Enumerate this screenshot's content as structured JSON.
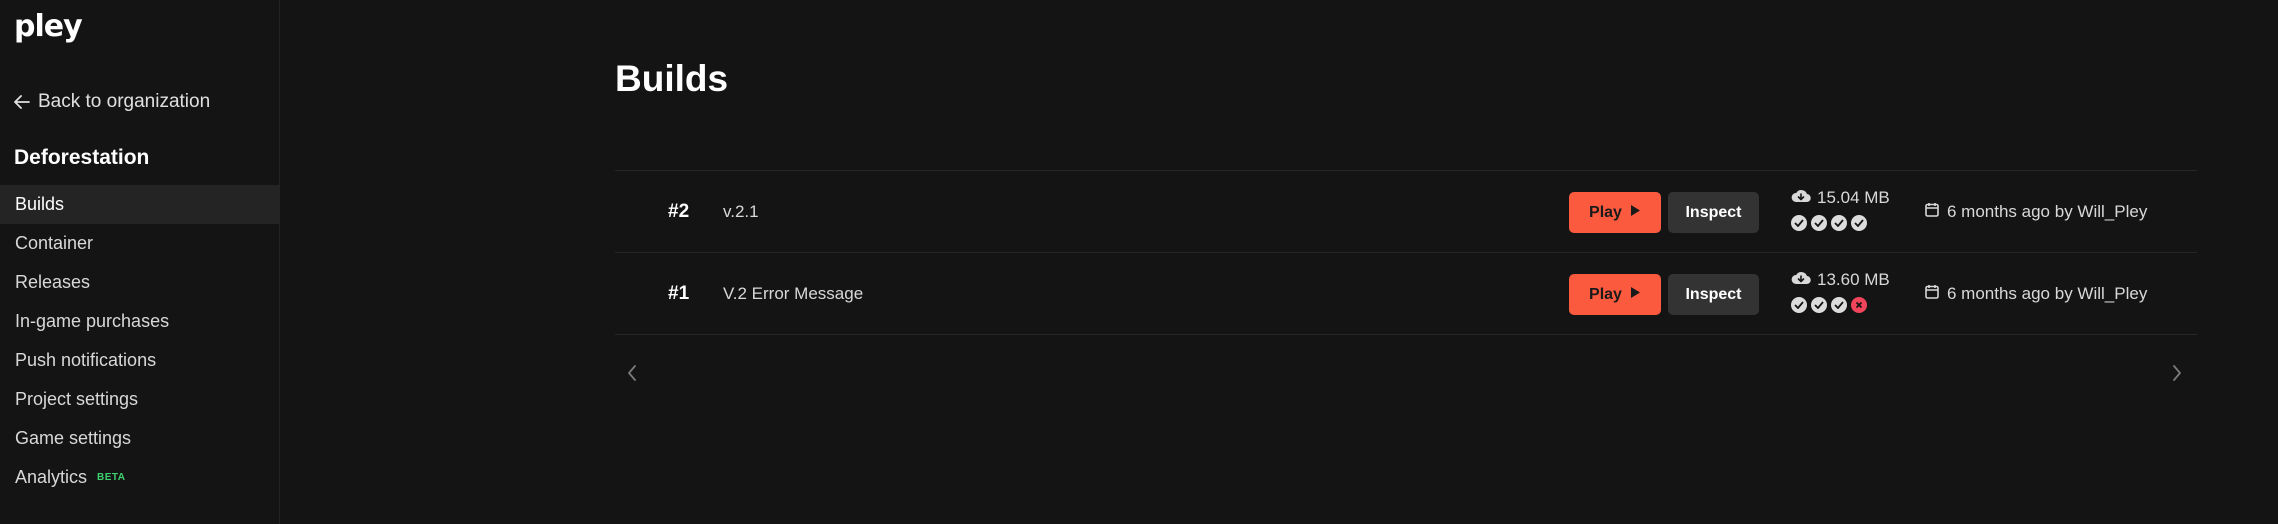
{
  "brand": {
    "logo_text": "pley"
  },
  "sidebar": {
    "back_label": "Back to organization",
    "project_name": "Deforestation",
    "items": [
      {
        "label": "Builds",
        "active": true
      },
      {
        "label": "Container"
      },
      {
        "label": "Releases"
      },
      {
        "label": "In-game purchases"
      },
      {
        "label": "Push notifications"
      },
      {
        "label": "Project settings"
      },
      {
        "label": "Game settings"
      },
      {
        "label": "Analytics",
        "badge": "BETA"
      }
    ]
  },
  "main": {
    "title": "Builds",
    "builds": [
      {
        "number": "#2",
        "name": "v.2.1",
        "play_label": "Play",
        "inspect_label": "Inspect",
        "size": "15.04 MB",
        "checks": [
          "pass",
          "pass",
          "pass",
          "pass"
        ],
        "meta": "6 months ago by Will_Pley"
      },
      {
        "number": "#1",
        "name": "V.2 Error Message",
        "play_label": "Play",
        "inspect_label": "Inspect",
        "size": "13.60 MB",
        "checks": [
          "pass",
          "pass",
          "pass",
          "fail"
        ],
        "meta": "6 months ago by Will_Pley"
      }
    ]
  },
  "colors": {
    "background": "#141414",
    "accent": "#fc5a3f",
    "secondary_button": "#333333",
    "beta": "#3ecf6e",
    "fail": "#f0455a"
  }
}
